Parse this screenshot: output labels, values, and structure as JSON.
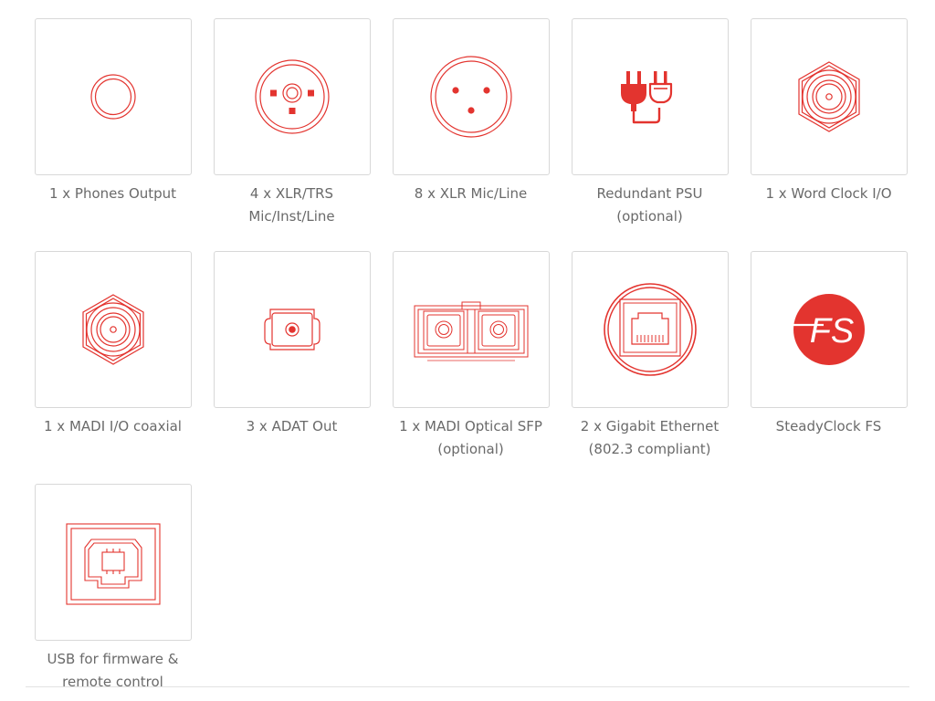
{
  "accent_color": "#e3342f",
  "features": [
    {
      "label": "1 x Phones Output",
      "icon": "phones-jack-icon"
    },
    {
      "label": "4 x XLR/TRS\nMic/Inst/Line",
      "icon": "xlr-trs-combo-icon"
    },
    {
      "label": "8 x XLR Mic/Line",
      "icon": "xlr-connector-icon"
    },
    {
      "label": "Redundant PSU\n(optional)",
      "icon": "power-plugs-icon"
    },
    {
      "label": "1 x Word Clock I/O",
      "icon": "bnc-connector-icon"
    },
    {
      "label": "1 x MADI I/O coaxial",
      "icon": "bnc-connector-icon"
    },
    {
      "label": "3 x ADAT Out",
      "icon": "optical-toslink-icon"
    },
    {
      "label": "1 x MADI Optical SFP\n(optional)",
      "icon": "sfp-duplex-icon"
    },
    {
      "label": "2 x Gigabit Ethernet\n(802.3 compliant)",
      "icon": "ethernet-port-icon"
    },
    {
      "label": "SteadyClock FS",
      "icon": "steadyclock-logo-icon",
      "logo_text": "FS"
    },
    {
      "label": "USB for firmware &\nremote control",
      "icon": "usb-b-port-icon"
    }
  ]
}
